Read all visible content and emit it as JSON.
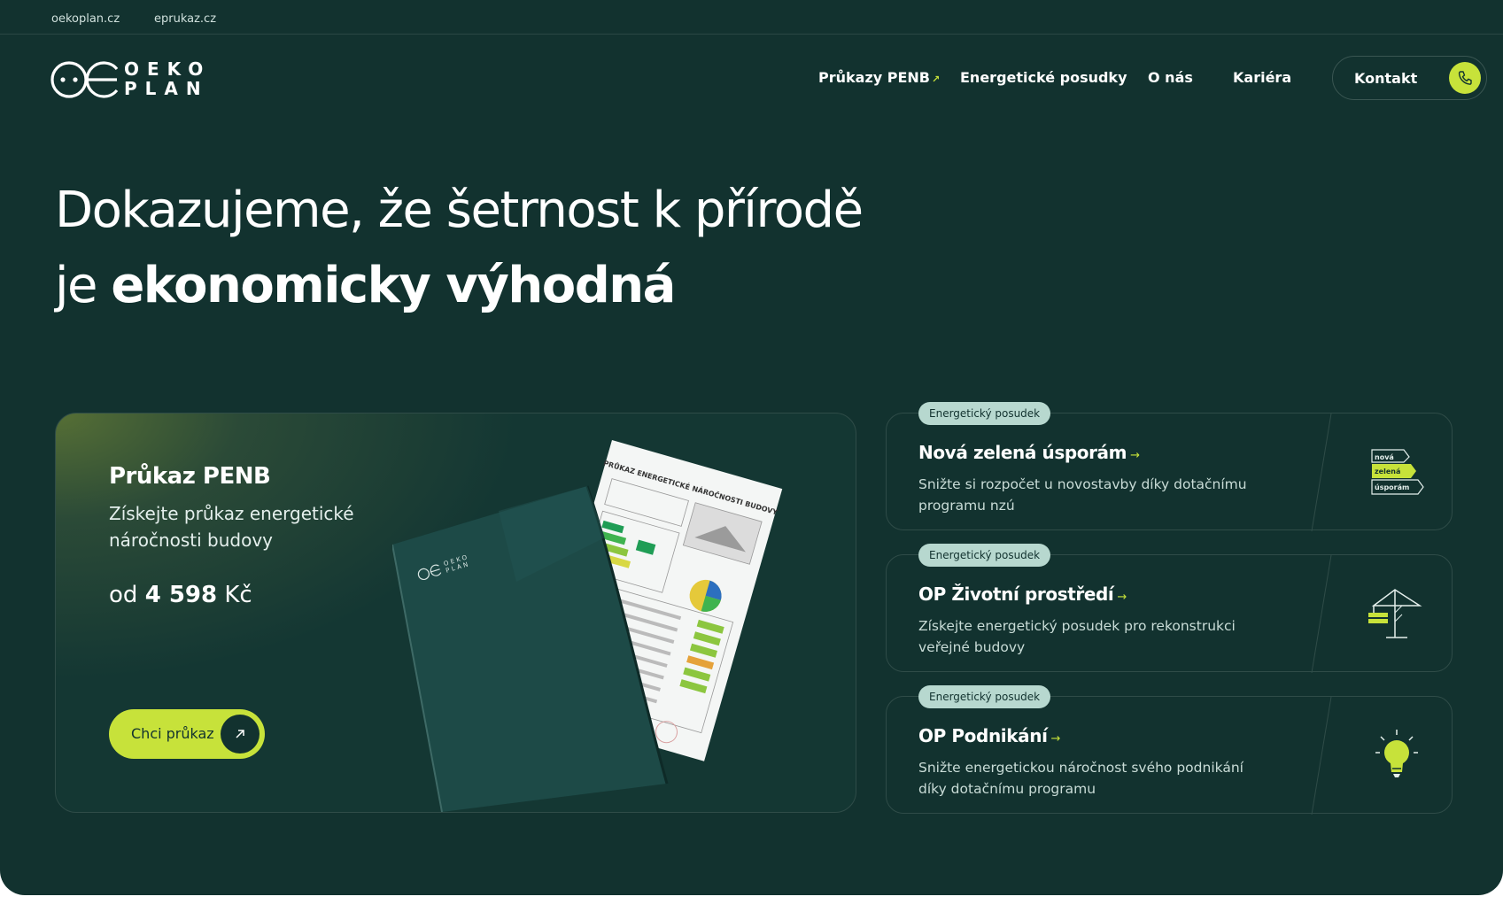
{
  "topbar": {
    "links": [
      "oekoplan.cz",
      "eprukaz.cz"
    ]
  },
  "logo": {
    "line1": "OEKO",
    "line2": "PLAN"
  },
  "nav": {
    "items": [
      "Průkazy PENB",
      "Energetické posudky",
      "O nás",
      "Kariéra"
    ],
    "external_marker": "↗",
    "contact": "Kontakt"
  },
  "hero": {
    "line1": "Dokazujeme, že šetrnost k přírodě",
    "line2_prefix": "je",
    "line2_bold": "ekonomicky výhodná"
  },
  "main_card": {
    "title": "Průkaz PENB",
    "subtitle": "Získejte průkaz energetické náročnosti budovy",
    "price_prefix": "od",
    "price_value": "4 598",
    "price_currency": "Kč",
    "cta": "Chci průkaz",
    "document_heading": "PRŮKAZ ENERGETICKÉ NÁROČNOSTI BUDOVY",
    "folder_logo": [
      "OEKO",
      "PLAN"
    ]
  },
  "side_cards": [
    {
      "badge": "Energetický posudek",
      "title": "Nová zelená úsporám",
      "description": "Snižte si rozpočet u novostavby díky dotačnímu programu nzú",
      "icon": "nzu-logo-icon",
      "icon_text": [
        "nová",
        "zelená",
        "úsporám"
      ]
    },
    {
      "badge": "Energetický posudek",
      "title": "OP Životní prostředí",
      "description": "Získejte energetický posudek pro rekonstrukci veřejné budovy",
      "icon": "crane-icon"
    },
    {
      "badge": "Energetický posudek",
      "title": "OP Podnikání",
      "description": "Snižte energetickou náročnost svého podnikání díky dotačnímu programu",
      "icon": "lightbulb-icon"
    }
  ],
  "colors": {
    "background": "#12322f",
    "accent": "#c7e23a",
    "badge": "#b7d8cf"
  }
}
